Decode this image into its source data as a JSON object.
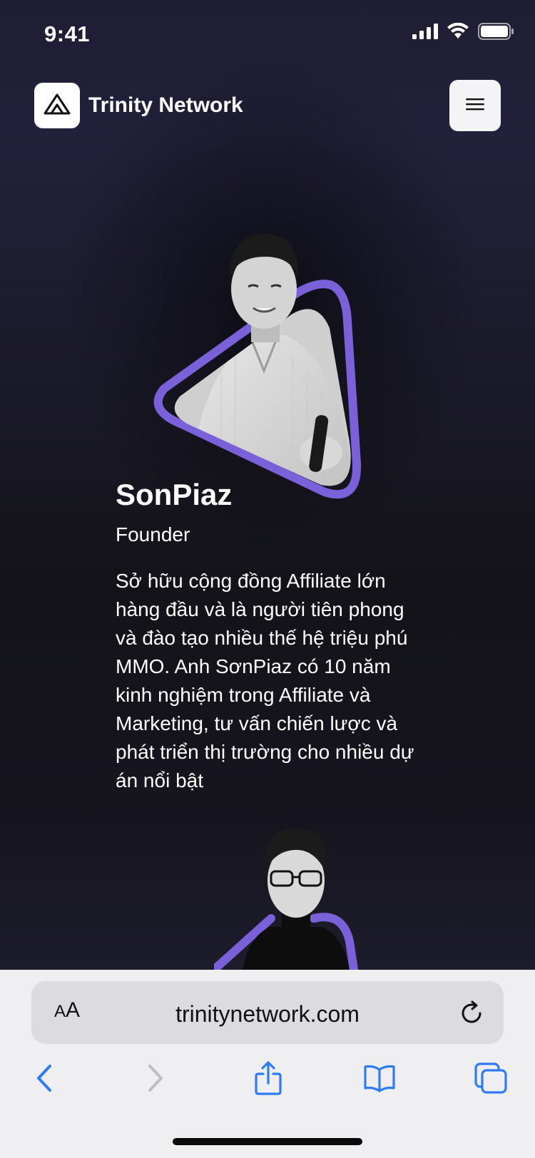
{
  "status_bar": {
    "time": "9:41"
  },
  "header": {
    "brand": "Trinity Network",
    "logo_icon": "trinity-triangle-logo",
    "menu_icon": "hamburger-menu-icon"
  },
  "team": [
    {
      "name": "SonPiaz",
      "role": "Founder",
      "bio": "Sở hữu cộng đồng Affiliate lớn hàng đầu và là người tiên phong và đào tạo nhiều thế hệ triệu phú MMO. Anh SơnPiaz có 10 năm kinh nghiệm trong Affiliate và Marketing, tư vấn chiến lược và phát triển thị trường cho nhiều dự án nổi bật"
    }
  ],
  "browser": {
    "aa_label_big": "A",
    "aa_label_small": "A",
    "url": "trinitynetwork.com"
  },
  "colors": {
    "accent": "#7b61d9",
    "background": "#14131c",
    "browser_bar": "#efeff1",
    "ios_blue": "#2f7bf5"
  }
}
